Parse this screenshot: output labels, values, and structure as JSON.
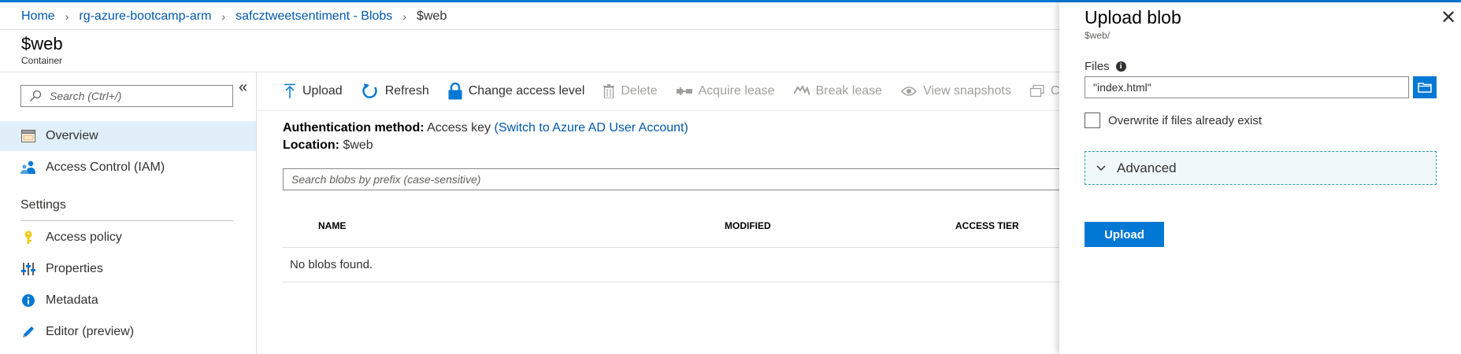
{
  "breadcrumb": {
    "home": "Home",
    "resource_group": "rg-azure-bootcamp-arm",
    "storage_blobs": "safcztweetsentiment - Blobs",
    "current": "$web"
  },
  "page": {
    "title": "$web",
    "subtitle": "Container"
  },
  "sidebar": {
    "search_placeholder": "Search (Ctrl+/)",
    "collapse_glyph": "«",
    "items": [
      {
        "label": "Overview",
        "icon": "overview-icon",
        "active": true
      },
      {
        "label": "Access Control (IAM)",
        "icon": "iam-icon",
        "active": false
      }
    ],
    "settings_header": "Settings",
    "settings_items": [
      {
        "label": "Access policy",
        "icon": "key-icon"
      },
      {
        "label": "Properties",
        "icon": "properties-icon"
      },
      {
        "label": "Metadata",
        "icon": "info-icon"
      },
      {
        "label": "Editor (preview)",
        "icon": "pencil-icon"
      }
    ]
  },
  "toolbar": {
    "upload": "Upload",
    "refresh": "Refresh",
    "change_access": "Change access level",
    "delete": "Delete",
    "acquire_lease": "Acquire lease",
    "break_lease": "Break lease",
    "view_snapshots": "View snapshots",
    "create_snapshot": "Cre"
  },
  "info": {
    "auth_label": "Authentication method:",
    "auth_value": "Access key",
    "auth_link": "(Switch to Azure AD User Account)",
    "location_label": "Location:",
    "location_value": "$web"
  },
  "blob_search": {
    "placeholder": "Search blobs by prefix (case-sensitive)"
  },
  "table": {
    "columns": [
      "NAME",
      "MODIFIED",
      "ACCESS TIER"
    ],
    "empty_message": "No blobs found."
  },
  "blade": {
    "title": "Upload blob",
    "subtitle": "$web/",
    "close_glyph": "✕",
    "files_label": "Files",
    "files_value": "\"index.html\"",
    "overwrite_label": "Overwrite if files already exist",
    "overwrite_checked": false,
    "advanced_label": "Advanced",
    "upload_button": "Upload"
  },
  "colors": {
    "accent": "#0078d4",
    "link": "#0058ad",
    "nav_active": "#e1effa",
    "advanced_border": "#27a0b6"
  }
}
